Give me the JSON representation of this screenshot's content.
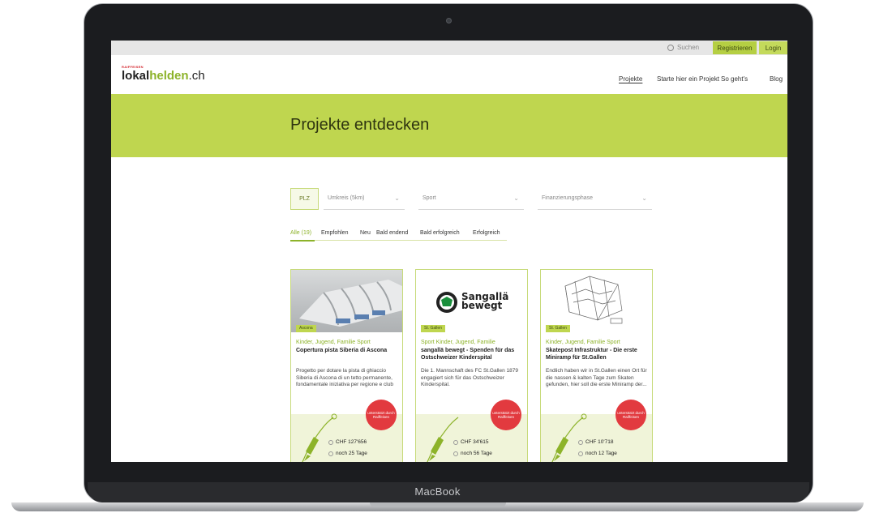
{
  "device": {
    "brand": "MacBook"
  },
  "topbar": {
    "search_label": "Suchen",
    "register_label": "Registrieren",
    "login_label": "Login"
  },
  "header": {
    "logo_small": "RAIFFEISEN",
    "logo_part1": "lokal",
    "logo_part2": "helden",
    "logo_tld": ".ch",
    "nav": [
      "Projekte",
      "Starte hier ein Projekt",
      "So geht's",
      "Blog"
    ]
  },
  "banner": {
    "title": "Projekte entdecken"
  },
  "filters": {
    "plz": "PLZ",
    "radius": "Umkreis (5km)",
    "sport": "Sport",
    "phase": "Finanzierungsphase"
  },
  "tabs": [
    "Alle (19)",
    "Empfohlen",
    "Neu",
    "Bald endend",
    "Bald erfolgreich",
    "Erfolgreich"
  ],
  "cards": [
    {
      "location": "Ascona",
      "category": "Kinder, Jugend, Familie Sport",
      "title": "Copertura pista Siberia di Ascona",
      "description": "Progetto per dotare la pista di ghiaccio Siberia di Ascona di un tetto permanente, fondamentale iniziativa per regione e club",
      "badge": "unterstützt durch Raiffeisen",
      "amount": "CHF 127'656",
      "days": "noch 25 Tage"
    },
    {
      "location": "St. Gallen",
      "category": "Sport Kinder, Jugend, Familie",
      "title": "sangallä bewegt - Spenden für das Ostschweizer Kinderspital",
      "description": "Die 1. Mannschaft des FC St.Gallen 1879 engagiert sich für das Ostschweizer Kinderspital.",
      "image_text_1": "Sangallä",
      "image_text_2": "bewegt",
      "badge": "unterstützt durch Raiffeisen",
      "amount": "CHF 34'615",
      "days": "noch 56 Tage"
    },
    {
      "location": "St. Gallen",
      "category": "Kinder, Jugend, Familie Sport",
      "title": "Skatepost Infrastruktur - Die erste Miniramp für St.Gallen",
      "description": "Endlich haben wir in St.Gallen einen Ort für die nassen & kalten Tage zum Skaten gefunden, hier soll die erste Miniramp der...",
      "badge": "unterstützt durch Raiffeisen",
      "amount": "CHF 10'718",
      "days": "noch 12 Tage"
    }
  ],
  "colors": {
    "brand_green": "#bfd64f",
    "accent_green": "#8db32a",
    "badge_red": "#e23a3f"
  }
}
